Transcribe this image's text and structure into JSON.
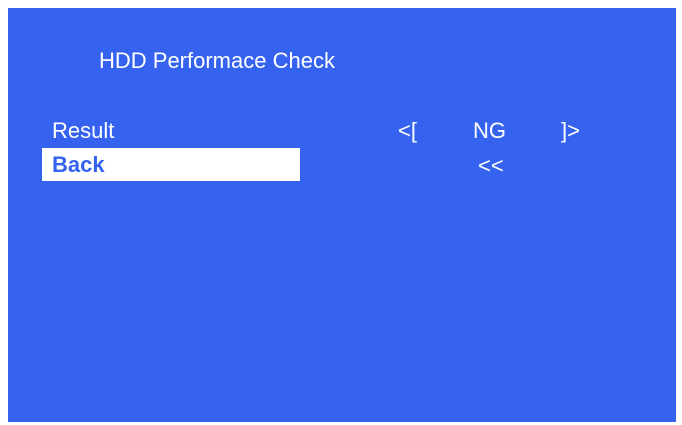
{
  "title": "HDD Performace Check",
  "menu": {
    "items": [
      {
        "label": "Result",
        "selected": false
      },
      {
        "label": "Back",
        "selected": true
      }
    ]
  },
  "result": {
    "left_bracket": "<[",
    "value": "NG",
    "right_bracket": "]>"
  },
  "back": {
    "value": "<<"
  },
  "colors": {
    "background": "#3563f0",
    "text": "#ffffff",
    "highlight_bg": "#ffffff",
    "highlight_text": "#3563f0"
  }
}
